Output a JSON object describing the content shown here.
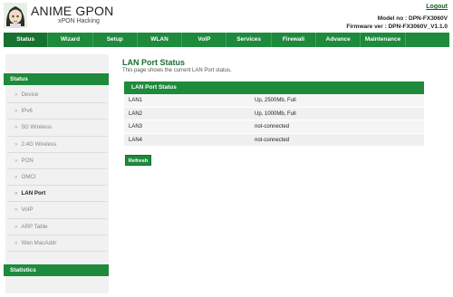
{
  "header": {
    "title": "ANIME GPON",
    "subtitle": "xPON Hacking",
    "logout": "Logout",
    "model": "Model no : DPN-FX3060V",
    "firmware": "Firmware ver : DPN-FX3060V_V1.1.0"
  },
  "nav": {
    "items": [
      "Status",
      "Wizard",
      "Setup",
      "WLAN",
      "VoIP",
      "Services",
      "Firewall",
      "Advance",
      "Maintenance",
      ""
    ]
  },
  "sidebar": {
    "section_status": "Status",
    "items": [
      "Device",
      "IPv6",
      "5G Wireless",
      "2.4G Wireless",
      "PON",
      "OMCI",
      "LAN Port",
      "VoIP",
      "ARP Table",
      "Wan MacAddr"
    ],
    "active_item": "LAN Port",
    "section_statistics": "Statistics",
    "arrow": "»"
  },
  "main": {
    "title": "LAN Port Status",
    "description": "This page shows the current LAN Port status.",
    "panel_title": "LAN Port Status",
    "rows": [
      {
        "port": "LAN1",
        "status": "Up, 2500Mb, Full"
      },
      {
        "port": "LAN2",
        "status": "Up, 1000Mb, Full"
      },
      {
        "port": "LAN3",
        "status": "not-connected"
      },
      {
        "port": "LAN4",
        "status": "not-connected"
      }
    ],
    "refresh_label": "Refresh"
  },
  "colors": {
    "accent": "#1e8a3c",
    "title": "#1b6e33"
  }
}
